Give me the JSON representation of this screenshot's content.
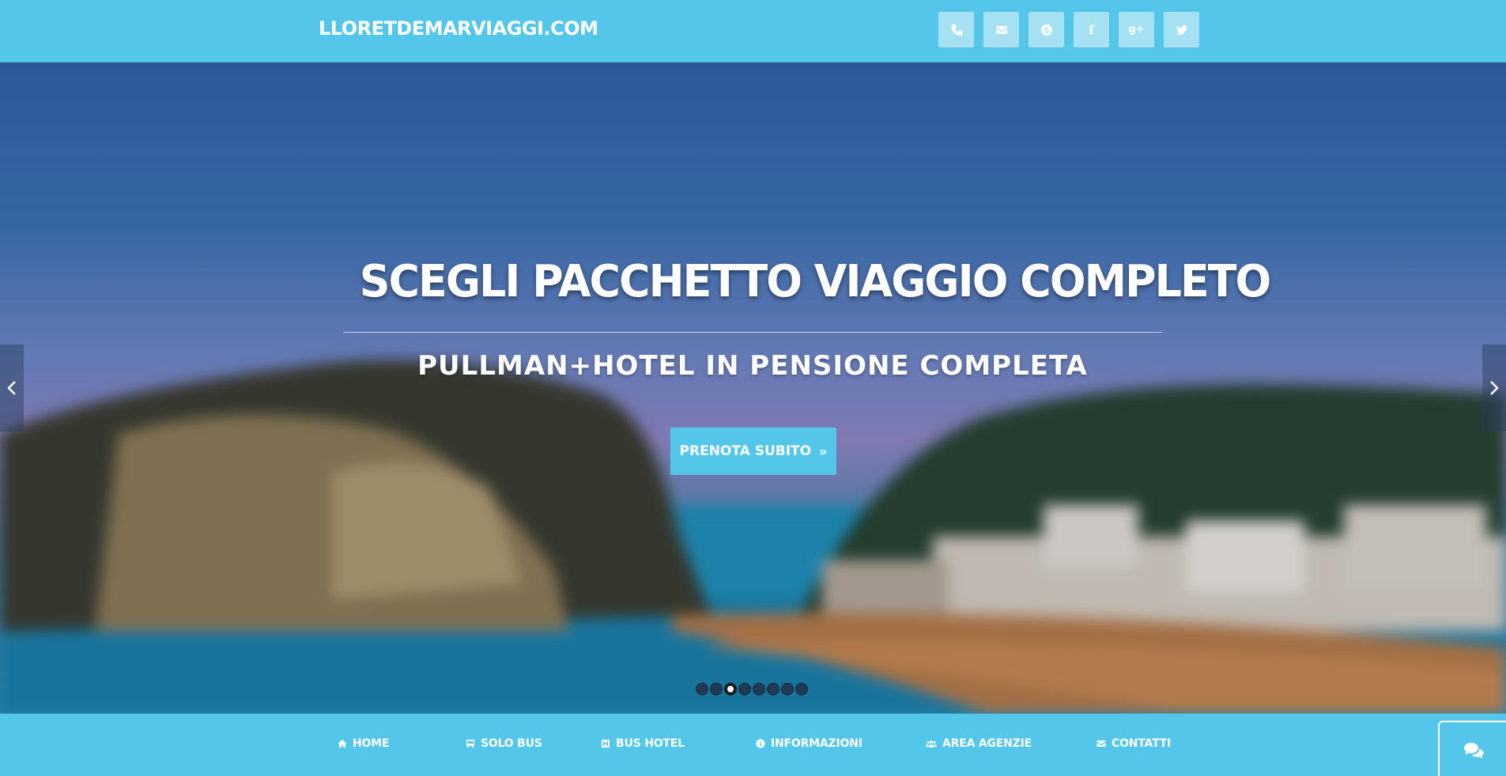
{
  "header": {
    "brand": "LLORETDEMARVIAGGI.COM",
    "social": [
      {
        "icon": "phone-icon",
        "label": ""
      },
      {
        "icon": "envelope-icon",
        "label": ""
      },
      {
        "icon": "skype-icon",
        "label": ""
      },
      {
        "icon": "facebook-icon",
        "label": "f"
      },
      {
        "icon": "google-plus-icon",
        "label": "g+"
      },
      {
        "icon": "twitter-icon",
        "label": ""
      }
    ]
  },
  "hero": {
    "title": "SCEGLI PACCHETTO VIAGGIO COMPLETO",
    "subtitle": "PULLMAN+HOTEL IN PENSIONE COMPLETA",
    "cta_label": "PRENOTA SUBITO",
    "cta_icon": "double-chevron-right-icon",
    "slide_count": 8,
    "active_slide": 3
  },
  "nav": {
    "items": [
      {
        "label": "HOME",
        "icon": "home-icon"
      },
      {
        "label": "SOLO BUS",
        "icon": "bus-icon"
      },
      {
        "label": "BUS HOTEL",
        "icon": "hotel-icon"
      },
      {
        "label": "INFORMAZIONI",
        "icon": "info-icon"
      },
      {
        "label": "AREA AGENZIE",
        "icon": "users-icon"
      },
      {
        "label": "CONTATTI",
        "icon": "envelope-icon"
      }
    ]
  },
  "chat": {
    "icon": "chat-bubbles-icon"
  },
  "colors": {
    "accent": "#54c6ea",
    "social_button": "#a5e0f3",
    "text": "#ffffff"
  }
}
